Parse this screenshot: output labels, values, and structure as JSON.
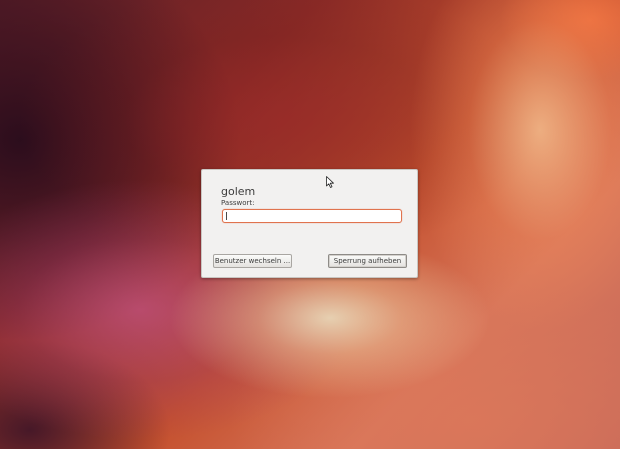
{
  "lock_screen": {
    "username": "golem",
    "password_label": "Passwort:",
    "password_value": "",
    "switch_user_button": "Benutzer wechseln ...",
    "unlock_button": "Sperrung aufheben"
  },
  "colors": {
    "dialog_background": "#f2f1f0",
    "focus_accent": "#e0734e",
    "wallpaper_primary": "#c4502e"
  },
  "icons": {
    "pointer": "mouse-pointer-icon"
  }
}
